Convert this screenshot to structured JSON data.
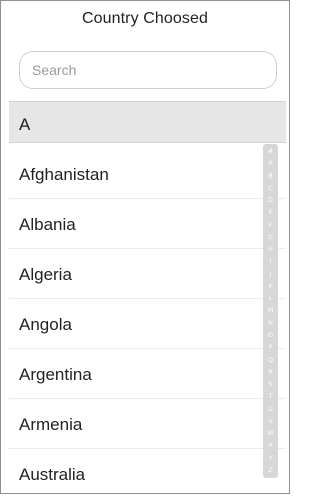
{
  "header": {
    "title": "Country Choosed"
  },
  "search": {
    "placeholder": "Search",
    "value": ""
  },
  "section": {
    "header": "A"
  },
  "countries": [
    "Afghanistan",
    "Albania",
    "Algeria",
    "Angola",
    "Argentina",
    "Armenia",
    "Australia"
  ],
  "index_letters": [
    "#",
    "A",
    "B",
    "C",
    "D",
    "E",
    "F",
    "G",
    "H",
    "I",
    "J",
    "K",
    "L",
    "M",
    "N",
    "O",
    "P",
    "Q",
    "R",
    "S",
    "T",
    "U",
    "V",
    "W",
    "X",
    "Y",
    "Z"
  ]
}
